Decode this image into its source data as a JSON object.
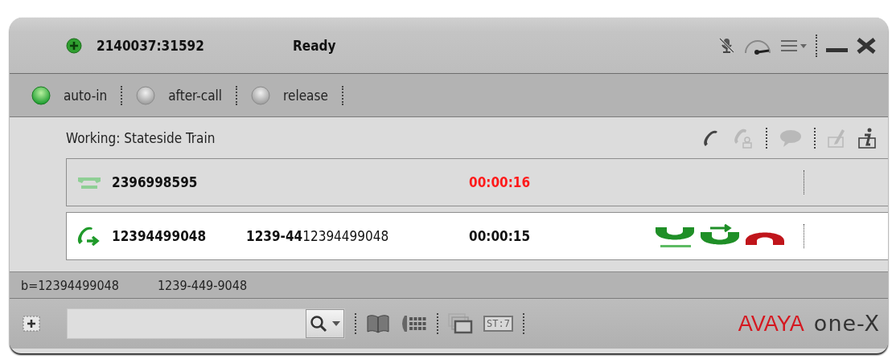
{
  "title_bar": {
    "extension": "2140037:31592",
    "status": "Ready"
  },
  "agent_states": [
    {
      "label": "auto-in",
      "selected": true
    },
    {
      "label": "after-call",
      "selected": false
    },
    {
      "label": "release",
      "selected": false
    }
  ],
  "work_panel": {
    "label": "Working: Stateside Train",
    "actions": [
      {
        "kind": "call",
        "disabled": false
      },
      {
        "kind": "conference",
        "disabled": true
      },
      {
        "kind": "chat",
        "disabled": true
      },
      {
        "kind": "note",
        "disabled": true
      },
      {
        "kind": "info",
        "disabled": false
      }
    ]
  },
  "calls": [
    {
      "kind": "held",
      "number": "2396998595",
      "timer": "00:00:16",
      "selected": false
    },
    {
      "kind": "active",
      "number": "12394499048",
      "name_cut": "1239-44",
      "name": "12394499048",
      "timer": "00:00:15",
      "selected": true
    }
  ],
  "info_bar": {
    "field_1": "b=12394499048",
    "field_2": "1239-449-9048"
  },
  "toolbar": {
    "status_key": "ST:7"
  },
  "logo": {
    "brand": "AVAYA",
    "product": "one-X"
  }
}
